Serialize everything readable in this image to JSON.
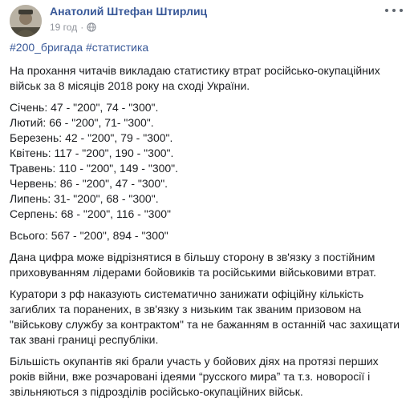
{
  "post": {
    "author": "Анатолий Штефан Штирлиц",
    "time": "19 год",
    "privacy_icon": "globe-icon",
    "more_icon": "more-options-icon",
    "hashtags": [
      "#200_бригада",
      "#статистика"
    ],
    "intro": "На прохання читачів викладаю статистику втрат російсько-окупаційних військ за 8 місяців 2018 року на сході України.",
    "months": [
      "Січень: 47 - \"200\", 74 - \"300\".",
      "Лютий: 66 - \"200\", 71- \"300\".",
      "Березень: 42 - \"200\", 79 - \"300\".",
      "Квітень: 117 - \"200\", 190 - \"300\".",
      "Травень: 110 - \"200\", 149 - \"300\".",
      "Червень: 86 - \"200\", 47 - \"300\".",
      "Липень: 31- \"200\", 68 - \"300\".",
      "Серпень: 68 - \"200\", 116 - \"300\""
    ],
    "total": "Всього: 567 - \"200\", 894 - \"300\"",
    "paragraphs": [
      "Дана цифра може відрізнятися в більшу сторону в зв'язку з постійним приховуванням лідерами бойовиків та російськими військовими втрат.",
      "Куратори з рф наказують систематично занижати офіційну кількість загиблих та поранених, в зв'язку з низьким так званим призовом на \"військову службу за контрактом\" та не бажанням в останній час захищати так звані границі республіки.",
      "Більшість окупантів які брали участь у бойових діях на протязі перших років війни, вже розчаровані ідеями “русского мира” та т.з. новоросії і звільняються з підрозділів російсько-окупаційних військ."
    ]
  }
}
